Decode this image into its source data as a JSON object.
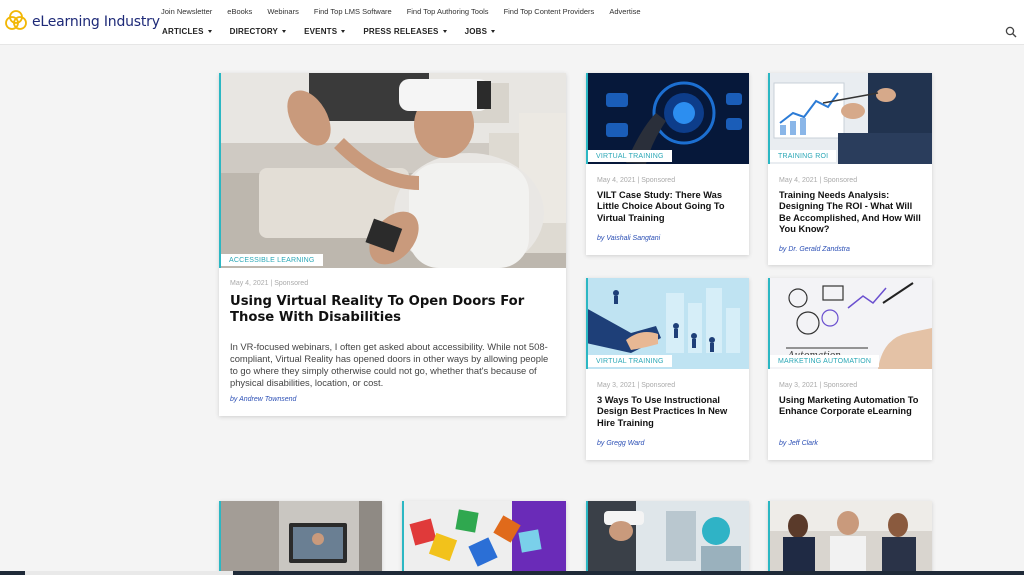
{
  "brand": {
    "name": "eLearning Industry"
  },
  "top_links": [
    "Join Newsletter",
    "eBooks",
    "Webinars",
    "Find Top LMS Software",
    "Find Top Authoring Tools",
    "Find Top Content Providers",
    "Advertise"
  ],
  "main_nav": [
    "ARTICLES",
    "DIRECTORY",
    "EVENTS",
    "PRESS RELEASES",
    "JOBS"
  ],
  "featured": {
    "category": "ACCESSIBLE LEARNING",
    "meta": "May 4, 2021 | Sponsored",
    "title": "Using Virtual Reality To Open Doors For Those With Disabilities",
    "excerpt": "In VR-focused webinars, I often get asked about accessibility. While not 508-compliant, Virtual Reality has opened doors in other ways by allowing people to go where they simply otherwise could not go, whether that's because of physical disabilities, location, or cost.",
    "author": "by Andrew Townsend"
  },
  "cards": [
    {
      "category": "VIRTUAL TRAINING",
      "meta": "May 4, 2021 | Sponsored",
      "title": "VILT Case Study: There Was Little Choice About Going To Virtual Training",
      "author": "by Vaishali Sangtani"
    },
    {
      "category": "TRAINING ROI",
      "meta": "May 4, 2021 | Sponsored",
      "title": "Training Needs Analysis: Designing The ROI - What Will Be Accomplished, And How Will You Know?",
      "author": "by Dr. Gerald Zandstra"
    },
    {
      "category": "VIRTUAL TRAINING",
      "meta": "May 3, 2021 | Sponsored",
      "title": "3 Ways To Use Instructional Design Best Practices In New Hire Training",
      "author": "by Gregg Ward"
    },
    {
      "category": "MARKETING AUTOMATION",
      "meta": "May 3, 2021 | Sponsored",
      "title": "Using Marketing Automation To Enhance Corporate eLearning",
      "author": "by Jeff Clark"
    }
  ],
  "colors": {
    "accent": "#2bb7c3",
    "author_link": "#2b4fb5",
    "brand_blue": "#1e2a78",
    "logo_yellow": "#f2b705"
  },
  "icons": {
    "logo": "elearning-logo-icon",
    "search": "search-icon",
    "caret": "chevron-down-icon"
  }
}
